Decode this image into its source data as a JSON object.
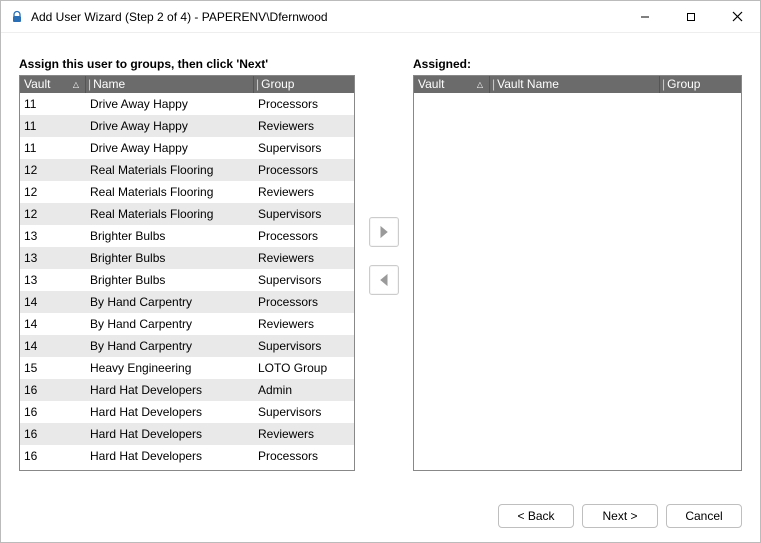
{
  "window": {
    "title": "Add User Wizard (Step 2 of 4) - PAPERENV\\Dfernwood"
  },
  "left": {
    "instruction": "Assign this user to groups, then click 'Next'",
    "headers": {
      "vault": "Vault",
      "name": "Name",
      "group": "Group"
    },
    "rows": [
      {
        "vault": "11",
        "name": "Drive Away Happy",
        "group": "Processors"
      },
      {
        "vault": "11",
        "name": "Drive Away Happy",
        "group": "Reviewers"
      },
      {
        "vault": "11",
        "name": "Drive Away Happy",
        "group": "Supervisors"
      },
      {
        "vault": "12",
        "name": "Real Materials Flooring",
        "group": "Processors"
      },
      {
        "vault": "12",
        "name": "Real Materials Flooring",
        "group": "Reviewers"
      },
      {
        "vault": "12",
        "name": "Real Materials Flooring",
        "group": "Supervisors"
      },
      {
        "vault": "13",
        "name": "Brighter Bulbs",
        "group": "Processors"
      },
      {
        "vault": "13",
        "name": "Brighter Bulbs",
        "group": "Reviewers"
      },
      {
        "vault": "13",
        "name": "Brighter Bulbs",
        "group": "Supervisors"
      },
      {
        "vault": "14",
        "name": "By Hand Carpentry",
        "group": "Processors"
      },
      {
        "vault": "14",
        "name": "By Hand Carpentry",
        "group": "Reviewers"
      },
      {
        "vault": "14",
        "name": "By Hand Carpentry",
        "group": "Supervisors"
      },
      {
        "vault": "15",
        "name": "Heavy Engineering",
        "group": "LOTO Group"
      },
      {
        "vault": "16",
        "name": "Hard Hat Developers",
        "group": "Admin"
      },
      {
        "vault": "16",
        "name": "Hard Hat Developers",
        "group": "Supervisors"
      },
      {
        "vault": "16",
        "name": "Hard Hat Developers",
        "group": "Reviewers"
      },
      {
        "vault": "16",
        "name": "Hard Hat Developers",
        "group": "Processors"
      }
    ]
  },
  "right": {
    "label": "Assigned:",
    "headers": {
      "vault": "Vault",
      "name": "Vault Name",
      "group": "Group"
    }
  },
  "buttons": {
    "back": "< Back",
    "next": "Next >",
    "cancel": "Cancel"
  }
}
